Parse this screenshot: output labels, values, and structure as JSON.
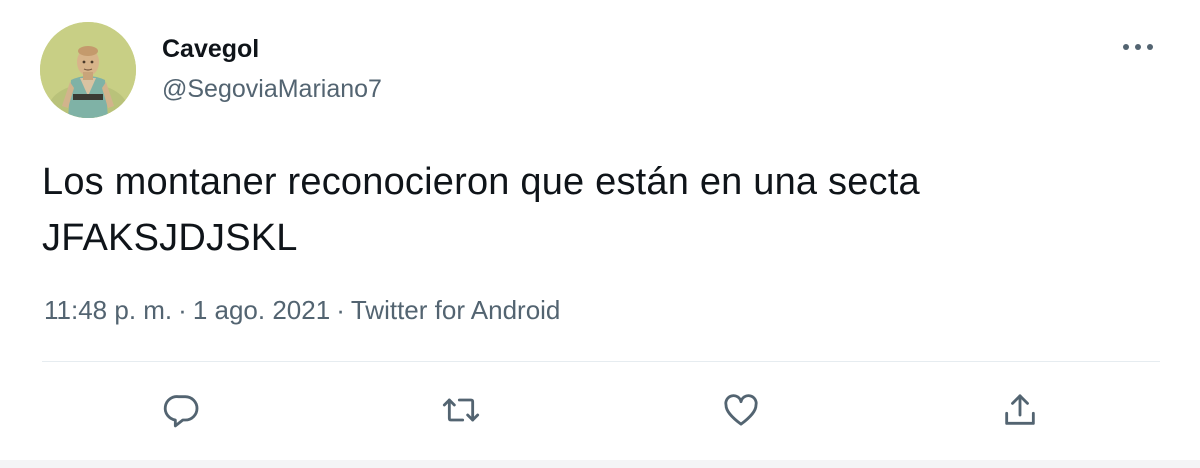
{
  "tweet": {
    "author": {
      "display_name": "Cavegol",
      "handle": "@SegoviaMariano7",
      "avatar": "avatar-illustration"
    },
    "text_lines": [
      "Los montaner reconocieron que están en una secta",
      "JFAKSJDJSKL"
    ],
    "meta": {
      "time": "11:48 p. m.",
      "separator": "·",
      "date": "1 ago. 2021",
      "source": "Twitter for Android"
    },
    "actions": {
      "reply_icon": "comment-icon",
      "retweet_icon": "retweet-icon",
      "like_icon": "heart-icon",
      "share_icon": "share-icon",
      "more_icon": "more-horizontal-icon"
    }
  },
  "colors": {
    "text_primary": "#0f1419",
    "text_secondary": "#536471",
    "divider": "#e6ecf0"
  }
}
